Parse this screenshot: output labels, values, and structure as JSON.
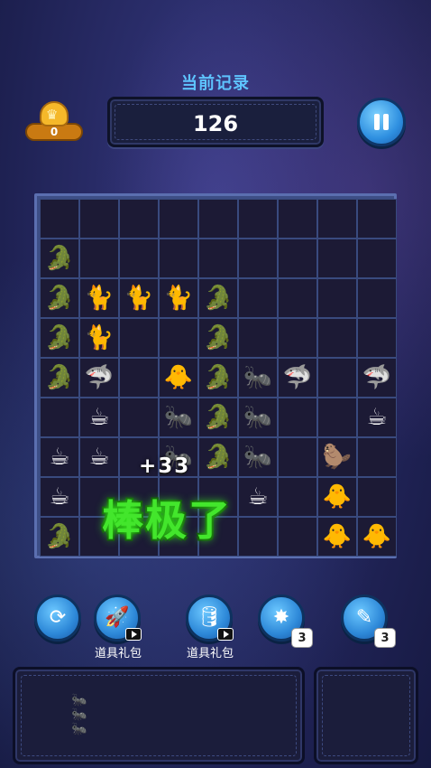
{
  "header": {
    "record_title": "当前记录",
    "score": "126",
    "crown_count": "0"
  },
  "board": {
    "rows": 9,
    "cols": 9,
    "cells": [
      [
        "",
        "",
        "",
        "",
        "",
        "",
        "",
        "",
        ""
      ],
      [
        "croc",
        "",
        "",
        "",
        "",
        "",
        "",
        "",
        ""
      ],
      [
        "croc",
        "cat",
        "cat",
        "cat",
        "croc",
        "",
        "",
        "",
        ""
      ],
      [
        "croc",
        "cat",
        "",
        "",
        "croc",
        "",
        "",
        "",
        ""
      ],
      [
        "croc",
        "shark",
        "",
        "duck",
        "croc",
        "ant",
        "shark",
        "",
        "shark"
      ],
      [
        "",
        "cup",
        "",
        "ant",
        "croc",
        "ant",
        "",
        "",
        "cup"
      ],
      [
        "cup",
        "cup",
        "",
        "ant",
        "croc",
        "ant",
        "",
        "capy",
        ""
      ],
      [
        "cup",
        "",
        "",
        "",
        "",
        "cup",
        "",
        "duck",
        ""
      ],
      [
        "croc",
        "",
        "",
        "",
        "",
        "",
        "",
        "duck",
        "duck"
      ]
    ],
    "icons": {
      "croc": "🐊",
      "cat": "🐈",
      "shark": "🦈",
      "duck": "🐥",
      "ant": "🐜",
      "cup": "☕",
      "capy": "🦫"
    }
  },
  "combo": {
    "points": "+33",
    "praise": "棒极了"
  },
  "tools": [
    {
      "name": "refresh",
      "glyph": "⟳",
      "label": "",
      "count": ""
    },
    {
      "name": "rocket",
      "glyph": "🚀",
      "label": "道具礼包",
      "count": ""
    },
    {
      "name": "barrel",
      "glyph": "🛢",
      "label": "道具礼包",
      "count": ""
    },
    {
      "name": "bomb",
      "glyph": "✸",
      "label": "",
      "count": "3"
    },
    {
      "name": "hammer",
      "glyph": "✎",
      "label": "",
      "count": "3"
    }
  ],
  "tray": {
    "piece_glyphs": [
      "𐀀",
      "𐀀",
      "𐀀"
    ]
  }
}
